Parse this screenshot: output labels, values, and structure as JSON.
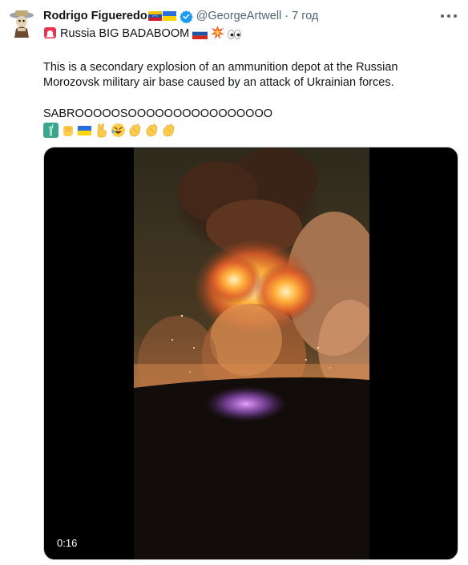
{
  "tweet": {
    "display_name": "Rodrigo Figueredo",
    "handle": "@GeorgeArtwell",
    "separator": "·",
    "time": "7 год",
    "lines": {
      "title_text": "Russia BIG BADABOOM",
      "body_1": "This is a secondary explosion of an ammunition depot at the Russian",
      "body_2": "Morozovsk military air base caused by an attack of Ukrainian forces.",
      "body_3": "SABROOOOOSOOOOOOOOOOOOOOOO"
    },
    "emoji_row": [
      "statue-of-liberty",
      "raised-fist",
      "ukraine-flag",
      "victory-hand",
      "rolling-laughing",
      "clapping-hands",
      "clapping-hands",
      "clapping-hands"
    ],
    "media": {
      "duration": "0:16"
    }
  },
  "colors": {
    "text": "#0f1419",
    "secondary": "#536471",
    "verified": "#1d9bf0",
    "media_bg": "#000000"
  }
}
